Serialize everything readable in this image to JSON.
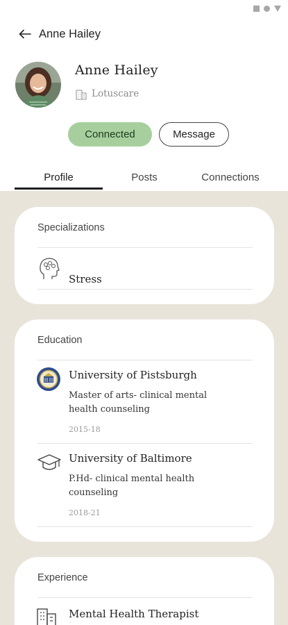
{
  "app_bar": {
    "title": "Anne Hailey"
  },
  "profile": {
    "name": "Anne Hailey",
    "organization": "Lotuscare"
  },
  "actions": {
    "connected_label": "Connected",
    "message_label": "Message"
  },
  "tabs": [
    {
      "label": "Profile",
      "active": true
    },
    {
      "label": "Posts",
      "active": false
    },
    {
      "label": "Connections",
      "active": false
    }
  ],
  "specializations": {
    "title": "Specializations",
    "items": [
      {
        "label": "Stress",
        "icon": "head-icon"
      }
    ]
  },
  "education": {
    "title": "Education",
    "items": [
      {
        "school": "University of Pistsburgh",
        "degree": "Master of arts- clinical mental health counseling",
        "years": "2015-18",
        "icon": "university-seal-icon"
      },
      {
        "school": "University of Baltimore",
        "degree": "P.Hd- clinical mental health counseling",
        "years": "2018-21",
        "icon": "graduation-cap-icon"
      }
    ]
  },
  "experience": {
    "title": "Experience",
    "items": [
      {
        "role": "Mental Health Therapist",
        "icon": "building-icon"
      }
    ]
  },
  "colors": {
    "accent_green": "#a7cf9e",
    "background_beige": "#e9e4da"
  }
}
